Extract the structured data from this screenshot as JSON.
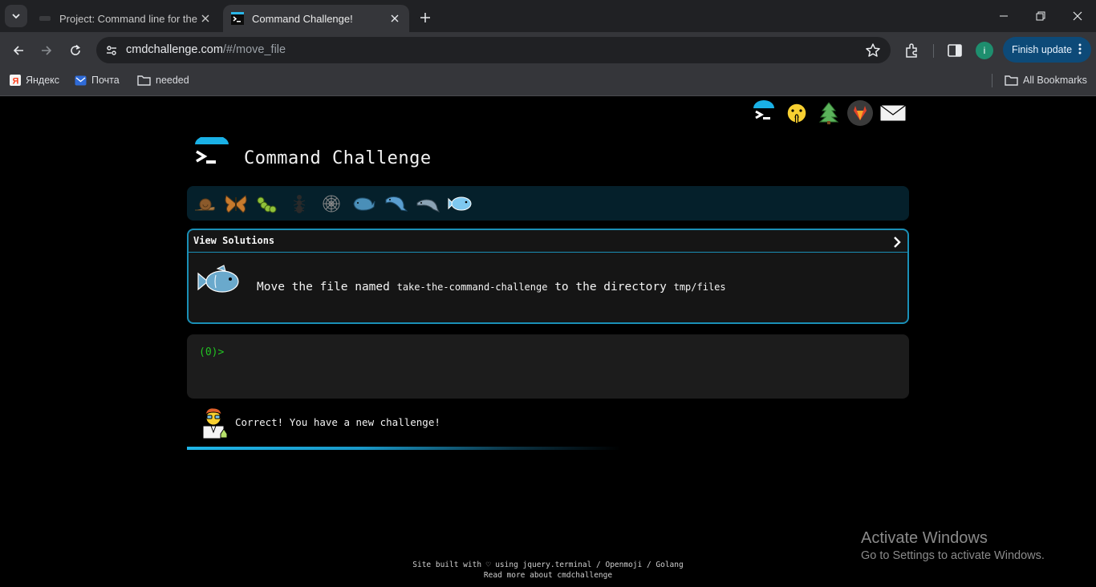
{
  "browser": {
    "tabs": [
      {
        "title": "Project: Command line for the w",
        "active": false
      },
      {
        "title": "Command Challenge!",
        "active": true
      }
    ],
    "url_host": "cmdchallenge.com",
    "url_path": "/#/move_file",
    "finish_update_label": "Finish update",
    "avatar_initial": "i",
    "bookmarks": [
      {
        "label": "Яндекс",
        "icon": "yandex-icon"
      },
      {
        "label": "Почта",
        "icon": "mail-icon"
      },
      {
        "label": "needed",
        "icon": "folder-icon"
      }
    ],
    "all_bookmarks_label": "All Bookmarks"
  },
  "page": {
    "social_icons": [
      "cmdchallenge-icon",
      "shushing-face-icon",
      "tree-icon",
      "gitlab-icon",
      "envelope-icon"
    ],
    "title": "Command Challenge",
    "levels": [
      "snail",
      "butterfly",
      "caterpillar",
      "ant",
      "spider-web",
      "whale",
      "dolphin",
      "dolphin",
      "fish"
    ],
    "challenge": {
      "header": "View Solutions",
      "text_before": "Move the file named",
      "filename": "take-the-command-challenge",
      "text_middle": "to the directory",
      "directory": "tmp/files",
      "icon": "fish-icon"
    },
    "terminal": {
      "prompt": "(0)>"
    },
    "status": {
      "message": "Correct! You have a new challenge!",
      "icon": "scientist-icon",
      "progress": 0.6
    },
    "footer": {
      "line1": "Site built with ♡ using jquery.terminal / Openmoji / Golang",
      "line2": "Read more about cmdchallenge"
    }
  },
  "os": {
    "activate_title": "Activate Windows",
    "activate_sub": "Go to Settings to activate Windows."
  },
  "colors": {
    "accent": "#1a8fb6",
    "prompt": "#22c322",
    "level_bar": "#05202b"
  }
}
